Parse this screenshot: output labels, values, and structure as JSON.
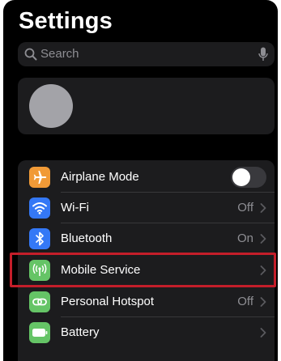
{
  "title": "Settings",
  "search": {
    "placeholder": "Search"
  },
  "colors": {
    "airplane": "#f19a37",
    "wifi": "#3478f6",
    "bluetooth": "#3478f6",
    "mobile": "#65c466",
    "hotspot": "#65c466",
    "battery": "#65c466",
    "highlight": "#c41e2a"
  },
  "settings": {
    "airplane": {
      "label": "Airplane Mode",
      "icon": "airplane-icon",
      "toggle_on": false
    },
    "wifi": {
      "label": "Wi-Fi",
      "value": "Off",
      "icon": "wifi-icon"
    },
    "bluetooth": {
      "label": "Bluetooth",
      "value": "On",
      "icon": "bluetooth-icon"
    },
    "mobile": {
      "label": "Mobile Service",
      "icon": "antenna-icon",
      "highlighted": true
    },
    "hotspot": {
      "label": "Personal Hotspot",
      "value": "Off",
      "icon": "hotspot-icon"
    },
    "battery": {
      "label": "Battery",
      "icon": "battery-icon"
    }
  }
}
